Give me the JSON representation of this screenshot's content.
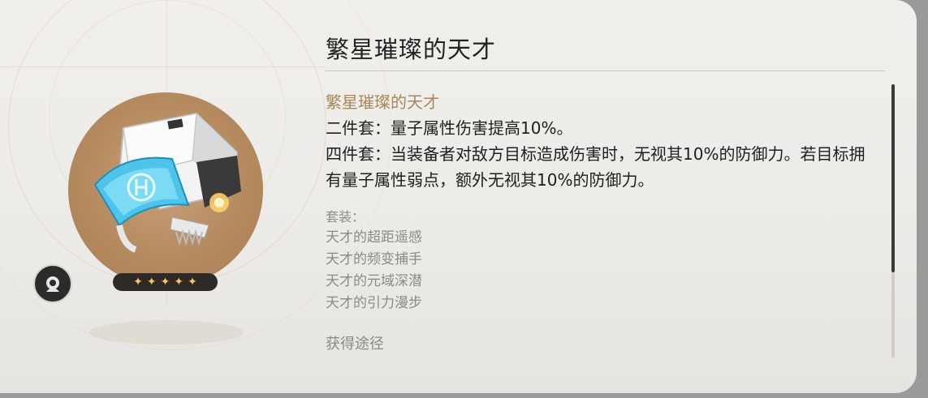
{
  "header": {
    "title": "繁星璀璨的天才"
  },
  "relic": {
    "set_name": "繁星璀璨的天才",
    "two_piece": "二件套：量子属性伤害提高10%。",
    "four_piece": "四件套：当装备者对敌方目标造成伤害时，无视其10%的防御力。若目标拥有量子属性弱点，额外无视其10%的防御力。",
    "rarity_stars": 5,
    "star_glyph": "✦",
    "path_icon": "erudition-path-icon"
  },
  "pieces": {
    "label": "套装：",
    "items": [
      "天才的超距遥感",
      "天才的频变捕手",
      "天才的元域深潜",
      "天才的引力漫步"
    ]
  },
  "acquire": {
    "label": "获得途径"
  },
  "colors": {
    "accent": "#a8875a",
    "circle": "#b58a5f",
    "star": "#f0c86a"
  }
}
